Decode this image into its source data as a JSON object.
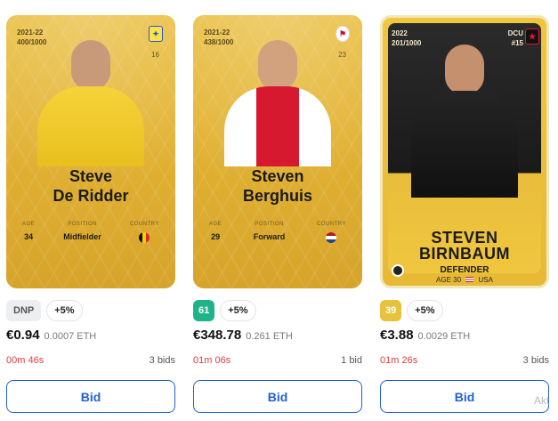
{
  "cards": [
    {
      "season": "2021-22",
      "serial": "400/1000",
      "player_first": "Steve",
      "player_last": "De Ridder",
      "number": "16",
      "stats": {
        "age_label": "AGE",
        "age": "34",
        "position_label": "POSITION",
        "position": "Midfielder",
        "country_label": "COUNTRY"
      },
      "score_badge": "DNP",
      "boost": "+5%",
      "price_fiat": "€0.94",
      "price_eth": "0.0007 ETH",
      "timer": "00m 46s",
      "bids": "3 bids",
      "bid_label": "Bid",
      "colors": {
        "score": "#eceef0"
      }
    },
    {
      "season": "2021-22",
      "serial": "438/1000",
      "player_first": "Steven",
      "player_last": "Berghuis",
      "number": "23",
      "stats": {
        "age_label": "AGE",
        "age": "29",
        "position_label": "POSITION",
        "position": "Forward",
        "country_label": "COUNTRY"
      },
      "score_badge": "61",
      "boost": "+5%",
      "price_fiat": "€348.78",
      "price_eth": "0.261 ETH",
      "timer": "01m 06s",
      "bids": "1 bid",
      "bid_label": "Bid",
      "colors": {
        "score": "#1fb38a"
      }
    },
    {
      "season": "2022",
      "serial": "201/1000",
      "club_code": "DCU",
      "shirt": "#15",
      "player_first": "STEVEN",
      "player_last": "BIRNBAUM",
      "position": "DEFENDER",
      "age_line": "AGE 30",
      "country_code": "USA",
      "score_badge": "39",
      "boost": "+5%",
      "price_fiat": "€3.88",
      "price_eth": "0.0029 ETH",
      "timer": "01m 26s",
      "bids": "3 bids",
      "bid_label": "Bid",
      "colors": {
        "score": "#e9c23b"
      }
    }
  ],
  "watermark": "Akt"
}
